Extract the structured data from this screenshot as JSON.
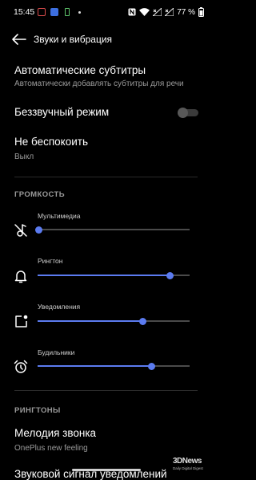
{
  "status_bar": {
    "time": "15:45",
    "battery_percent": "77 %"
  },
  "header": {
    "title": "Звуки и вибрация"
  },
  "items": {
    "auto_captions": {
      "title": "Автоматические субтитры",
      "subtitle": "Автоматически добавлять субтитры для речи"
    },
    "silent_mode": {
      "title": "Беззвучный режим",
      "enabled": false
    },
    "dnd": {
      "title": "Не беспокоить",
      "subtitle": "Выкл"
    }
  },
  "volume": {
    "section_title": "ГРОМКОСТЬ",
    "sliders": [
      {
        "label": "Мультимедиа",
        "icon": "music-off-icon",
        "level": 0.01
      },
      {
        "label": "Рингтон",
        "icon": "bell-icon",
        "level": 0.87
      },
      {
        "label": "Уведомления",
        "icon": "notification-icon",
        "level": 0.69
      },
      {
        "label": "Будильники",
        "icon": "alarm-clock-icon",
        "level": 0.75
      }
    ]
  },
  "ringtones": {
    "section_title": "РИНГТОНЫ",
    "ringtone": {
      "title": "Мелодия звонка",
      "subtitle": "OnePlus new feeling"
    },
    "notification_sound": {
      "title": "Звуковой сигнал уведомлений"
    }
  },
  "watermark": {
    "logo": "3DNews",
    "tagline": "Daily Digital Digest"
  },
  "colors": {
    "accent": "#5b7bf0",
    "background": "#000000",
    "secondary_text": "#9a9a9a"
  }
}
